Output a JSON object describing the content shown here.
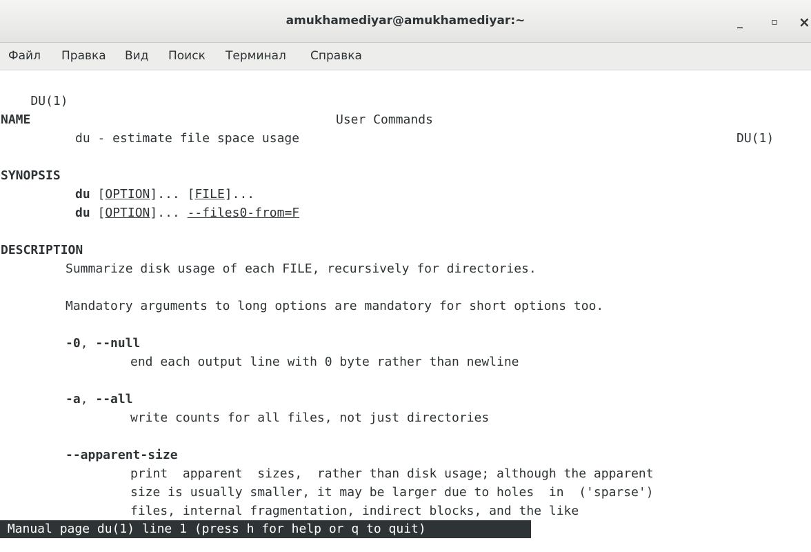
{
  "window": {
    "title": "amukhamediyar@amukhamediyar:~",
    "minimize": "_",
    "maximize": "▫",
    "close": "×"
  },
  "menu": [
    "Файл",
    "Правка",
    "Вид",
    "Поиск",
    "Терминал",
    "Справка"
  ],
  "man": {
    "header_left": "DU(1)",
    "header_center": "User Commands",
    "header_right": "DU(1)",
    "name_heading": "NAME",
    "name_text": "du - estimate file space usage",
    "synopsis_heading": "SYNOPSIS",
    "syn1_cmd": "du",
    "syn1_opt": "OPTION",
    "syn1_mid": "]... [",
    "syn1_file": "FILE",
    "syn1_end": "]...",
    "syn2_cmd": "du",
    "syn2_opt": "OPTION",
    "syn2_mid": "]... ",
    "syn2_files0": "--files0-from=F",
    "description_heading": "DESCRIPTION",
    "desc1": "Summarize disk usage of each FILE, recursively for directories.",
    "desc2": "Mandatory arguments to long options are mandatory for short options too.",
    "opt_null_flag1": "-0",
    "opt_null_flag2": "--null",
    "opt_null_desc": "end each output line with 0 byte rather than newline",
    "opt_all_flag1": "-a",
    "opt_all_flag2": "--all",
    "opt_all_desc": "write counts for all files, not just directories",
    "opt_apparent_flag": "--apparent-size",
    "opt_apparent_desc1": "print  apparent  sizes,  rather than disk usage; although the apparent",
    "opt_apparent_desc2": "size is usually smaller, it may be larger due to holes  in  ('sparse')",
    "opt_apparent_desc3": "files, internal fragmentation, indirect blocks, and the like"
  },
  "status_line": " Manual page du(1) line 1 (press h for help or q to quit)"
}
